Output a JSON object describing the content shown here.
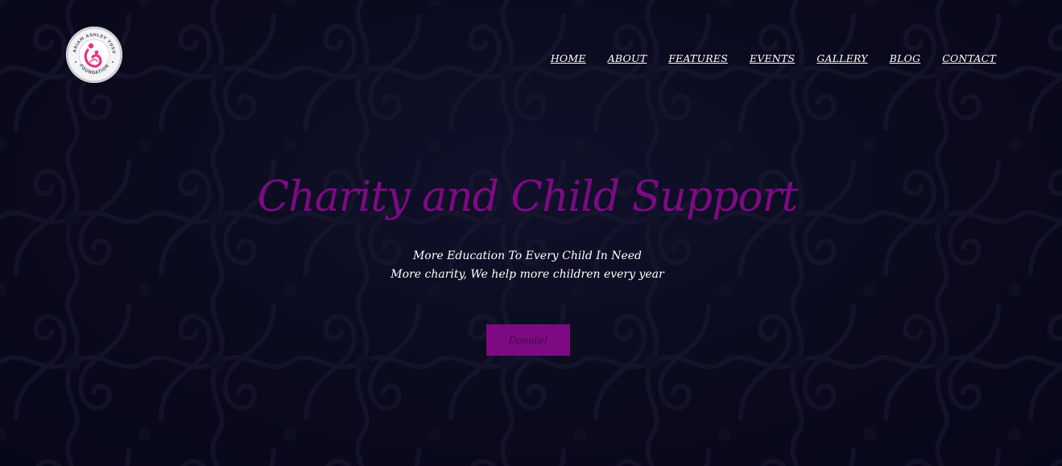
{
  "brand": {
    "logo_text_top": "MARIAM ASHLEY YUSUF",
    "logo_text_bottom": "FOUNDATION",
    "logo_color": "#e4338a"
  },
  "nav": {
    "items": [
      {
        "label": "HOME"
      },
      {
        "label": "ABOUT"
      },
      {
        "label": "FEATURES"
      },
      {
        "label": "EVENTS"
      },
      {
        "label": "GALLERY"
      },
      {
        "label": "BLOG"
      },
      {
        "label": "CONTACT"
      }
    ]
  },
  "hero": {
    "title": "Charity and Child Support",
    "subtitle_line1": "More Education To Every Child In Need",
    "subtitle_line2": "More charity, We help more children every year",
    "cta_label": "Donate!"
  },
  "colors": {
    "accent": "#7d0a82",
    "background": "#0a0a1a",
    "text": "#ffffff"
  }
}
